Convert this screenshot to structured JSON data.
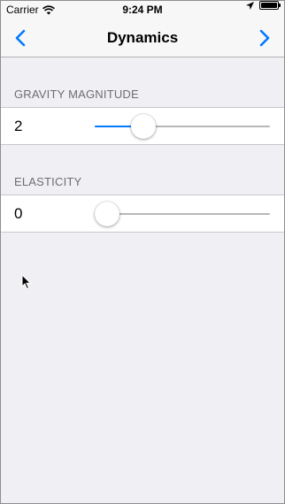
{
  "status_bar": {
    "carrier": "Carrier",
    "time": "9:24 PM",
    "icons": [
      "wifi-icon",
      "location-icon",
      "battery-icon"
    ]
  },
  "nav": {
    "title": "Dynamics",
    "back_icon": "chevron-left-icon",
    "forward_icon": "chevron-right-icon",
    "tint_color": "#007aff"
  },
  "sections": [
    {
      "header": "GRAVITY MAGNITUDE",
      "value": "2",
      "slider_fraction": 0.24
    },
    {
      "header": "ELASTICITY",
      "value": "0",
      "slider_fraction": 0.0
    }
  ],
  "colors": {
    "background": "#efeff4",
    "accent": "#007aff",
    "section_header": "#6d6d72"
  },
  "cursor_icon": "mouse-pointer-icon"
}
